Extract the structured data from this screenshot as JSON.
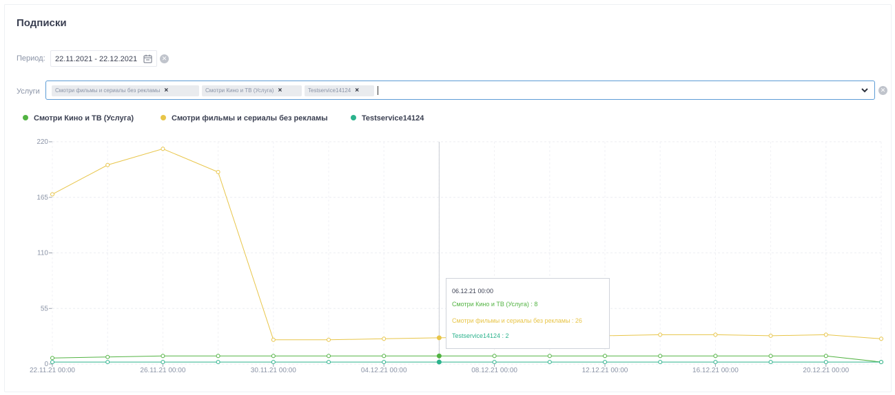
{
  "page": {
    "title": "Подписки",
    "period_label": "Период:",
    "period_value": "22.11.2021 - 22.12.2021",
    "services_label": "Услуги",
    "service_tags": [
      "Смотри фильмы и сериалы без рекламы",
      "Смотри Кино и ТВ (Услуга)",
      "Testservice14124"
    ]
  },
  "colors": {
    "green": "#52b342",
    "yellow": "#e8c548",
    "teal": "#2bb28c",
    "input_border": "#5b9bd5"
  },
  "icons": [
    "calendar-icon",
    "clear-icon",
    "tag-remove-icon",
    "chevron-down-icon"
  ],
  "chart_data": {
    "type": "line",
    "legend_placement": "top-left",
    "grid": true,
    "ylim": [
      0,
      220
    ],
    "y_ticks": [
      "220",
      "165",
      "110",
      "55",
      "0"
    ],
    "x_tick_labels": [
      "22.11.21 00:00",
      "26.11.21 00:00",
      "30.11.21 00:00",
      "04.12.21 00:00",
      "08.12.21 00:00",
      "12.12.21 00:00",
      "16.12.21 00:00",
      "20.12.21 00:00"
    ],
    "x": [
      "22.11.21",
      "24.11.21",
      "26.11.21",
      "28.11.21",
      "30.11.21",
      "02.12.21",
      "04.12.21",
      "06.12.21",
      "08.12.21",
      "10.12.21",
      "12.12.21",
      "14.12.21",
      "16.12.21",
      "18.12.21",
      "20.12.21",
      "22.12.21"
    ],
    "series": [
      {
        "name": "Смотри Кино и ТВ (Услуга)",
        "color": "#52b342",
        "values": [
          6,
          7,
          8,
          8,
          8,
          8,
          8,
          8,
          8,
          8,
          8,
          8,
          8,
          8,
          8,
          2
        ]
      },
      {
        "name": "Смотри фильмы и сериалы без рекламы",
        "color": "#e8c548",
        "values": [
          168,
          197,
          213,
          190,
          24,
          24,
          25,
          26,
          27,
          27,
          28,
          29,
          29,
          28,
          29,
          25
        ]
      },
      {
        "name": "Testservice14124",
        "color": "#2bb28c",
        "values": [
          2,
          2,
          2,
          2,
          2,
          2,
          2,
          2,
          2,
          2,
          2,
          2,
          2,
          2,
          2,
          2
        ]
      }
    ],
    "hover_index": 7,
    "tooltip": {
      "title": "06.12.21 00:00",
      "lines": [
        "Смотри Кино и ТВ (Услуга) : 8",
        "Смотри фильмы и сериалы без рекламы : 26",
        "Testservice14124 : 2"
      ]
    }
  }
}
